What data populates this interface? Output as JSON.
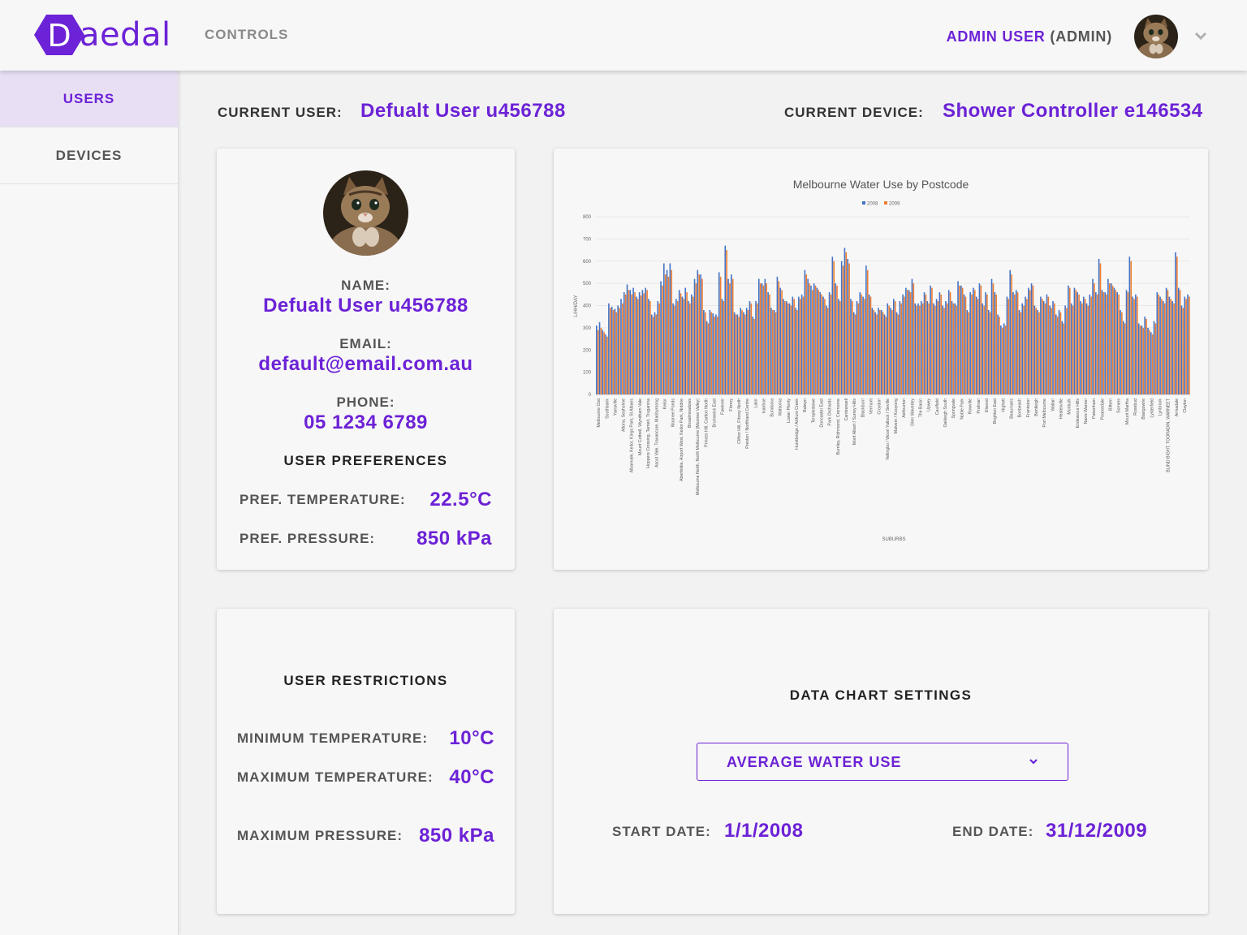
{
  "brand": {
    "logo_text": "aedal",
    "logo_letter": "D",
    "accent_color": "#6c22d6"
  },
  "topbar": {
    "nav_controls": "CONTROLS",
    "admin_name": "ADMIN USER",
    "admin_role": "(ADMIN)",
    "avatar_icon": "cat-avatar",
    "menu_icon": "chevron-down-icon"
  },
  "sidebar": {
    "items": [
      {
        "label": "USERS",
        "active": true
      },
      {
        "label": "DEVICES",
        "active": false
      }
    ]
  },
  "header": {
    "current_user_label": "CURRENT USER:",
    "current_user_value": "Defualt User u456788",
    "current_device_label": "CURRENT DEVICE:",
    "current_device_value": "Shower Controller e146534"
  },
  "user_card": {
    "name_label": "NAME:",
    "name_value": "Defualt User u456788",
    "email_label": "EMAIL:",
    "email_value": "default@email.com.au",
    "phone_label": "PHONE:",
    "phone_value": "05 1234 6789",
    "prefs_heading": "USER PREFERENCES",
    "pref_temp_label": "PREF. TEMPERATURE:",
    "pref_temp_value": "22.5°C",
    "pref_pressure_label": "PREF. PRESSURE:",
    "pref_pressure_value": "850 kPa"
  },
  "restrictions": {
    "heading": "USER RESTRICTIONS",
    "min_temp_label": "MINIMUM TEMPERATURE:",
    "min_temp_value": "10°C",
    "max_temp_label": "MAXIMUM TEMPERATURE:",
    "max_temp_value": "40°C",
    "max_pressure_label": "MAXIMUM PRESSURE:",
    "max_pressure_value": "850 kPa"
  },
  "chart_settings": {
    "heading": "DATA CHART SETTINGS",
    "dropdown_value": "AVERAGE WATER USE",
    "start_label": "START DATE:",
    "start_value": "1/1/2008",
    "end_label": "END DATE:",
    "end_value": "31/12/2009"
  },
  "chart_data": {
    "type": "bar",
    "title": "Melbourne Water Use by Postcode",
    "xlabel": "SUBURBS",
    "ylabel": "L/HH/DAY",
    "ylim": [
      0,
      800
    ],
    "yticks": [
      0,
      100,
      200,
      300,
      400,
      500,
      600,
      700,
      800
    ],
    "grid": true,
    "legend_position": "top",
    "series_colors": [
      "#4472c4",
      "#ed7d31"
    ],
    "labeled_categories": [
      "Melbourne Cbd",
      "Southbank",
      "Yarraville",
      "Altona, Seaholme",
      "Albanvale, Keilor, Kings Park, St Albans",
      "Mount Cottrell, Wyndham Vale",
      "Hoppers Crossing, Tarneit, Truganina",
      "Ascot Vale, Travancore, Maribyrnong",
      "Keilor",
      "Moonee Ponds",
      "Aberfeldie, Airport West, Keilor Park, Niddrie",
      "Broadmeadows",
      "Melbourne North, North Melbourne (Moonee Valley)",
      "Princes Hill, Carlton North",
      "Brunswick East",
      "Fawkner",
      "Fitzroy",
      "Clifton Hill, Fitzroy North",
      "Preston / Northland Centre",
      "Lalor",
      "Ivanhoe",
      "Bundoora",
      "Watsonia",
      "Lower Plenty",
      "Hurstbridge / Arthurs Creek",
      "Balwyn",
      "Templestowe",
      "Doncaster East",
      "Park Orchards",
      "Burnley, Richmond, Cremorne",
      "Camberwell",
      "Mont Albert / Surrey Hills",
      "Blackburn",
      "Vermont",
      "Croydon",
      "Yellingbo / Woori Yallock / Seville",
      "Malvern / Kooyong",
      "Ashburton",
      "Glen Waverley",
      "The Basin",
      "Upwey",
      "Caulfield",
      "Oakleigh South",
      "Springvale",
      "Noble Park",
      "Rowville",
      "Prahran",
      "Elwood",
      "Brighton East",
      "Highett",
      "Beaumaris",
      "Bonbeach",
      "Frankston",
      "Bentleigh",
      "Port Melbourne",
      "Wallan",
      "Healesville",
      "Monbulk",
      "Endeavour Hills",
      "Narre Warren",
      "Pakenham",
      "Pearcedale",
      "Bittern",
      "Somers",
      "Mount Martha",
      "Rosebud",
      "Blairgowrie",
      "Lysterfield",
      "Lynbrook",
      "BLIND BIGHT, TOORADIN, WARNEET",
      "Armadale",
      "Clayton"
    ],
    "series": [
      {
        "name": "2008",
        "values": [
          310,
          325,
          290,
          270,
          410,
          395,
          385,
          400,
          430,
          460,
          495,
          470,
          480,
          440,
          460,
          470,
          480,
          430,
          360,
          370,
          420,
          510,
          590,
          560,
          590,
          410,
          430,
          470,
          440,
          480,
          420,
          450,
          520,
          560,
          540,
          380,
          330,
          380,
          365,
          360,
          550,
          430,
          670,
          520,
          540,
          370,
          360,
          390,
          370,
          390,
          420,
          350,
          420,
          520,
          500,
          520,
          460,
          390,
          380,
          530,
          480,
          430,
          420,
          410,
          440,
          390,
          440,
          450,
          560,
          520,
          490,
          500,
          480,
          460,
          440,
          400,
          460,
          620,
          500,
          430,
          600,
          660,
          610,
          430,
          370,
          420,
          460,
          440,
          580,
          450,
          390,
          370,
          390,
          380,
          360,
          410,
          390,
          430,
          370,
          420,
          450,
          480,
          470,
          520,
          410,
          410,
          420,
          460,
          420,
          490,
          410,
          430,
          460,
          400,
          420,
          470,
          420,
          410,
          510,
          490,
          450,
          380,
          460,
          480,
          440,
          500,
          410,
          460,
          380,
          520,
          460,
          360,
          310,
          320,
          440,
          560,
          460,
          470,
          380,
          410,
          440,
          480,
          500,
          400,
          380,
          440,
          420,
          450,
          400,
          420,
          360,
          380,
          330,
          400,
          490,
          410,
          480,
          460,
          420,
          440,
          410,
          450,
          520,
          460,
          610,
          470,
          460,
          520,
          500,
          480,
          460,
          380,
          330,
          470,
          620,
          440,
          450,
          320,
          310,
          350,
          300,
          280,
          330,
          460,
          440,
          420,
          480,
          440,
          420,
          640,
          480,
          400,
          440,
          450
        ]
      },
      {
        "name": "2009",
        "values": [
          290,
          300,
          280,
          260,
          390,
          380,
          370,
          390,
          410,
          450,
          470,
          450,
          460,
          430,
          445,
          455,
          470,
          420,
          350,
          360,
          410,
          490,
          540,
          530,
          560,
          400,
          420,
          455,
          430,
          460,
          410,
          440,
          500,
          540,
          520,
          370,
          320,
          370,
          350,
          350,
          530,
          420,
          650,
          500,
          520,
          360,
          350,
          380,
          360,
          380,
          410,
          340,
          410,
          500,
          490,
          500,
          450,
          380,
          370,
          510,
          470,
          420,
          410,
          400,
          430,
          380,
          430,
          440,
          540,
          500,
          470,
          490,
          470,
          450,
          430,
          390,
          450,
          600,
          490,
          420,
          580,
          640,
          590,
          420,
          360,
          410,
          450,
          430,
          560,
          440,
          380,
          360,
          380,
          370,
          350,
          400,
          380,
          420,
          360,
          410,
          440,
          470,
          460,
          500,
          400,
          400,
          410,
          450,
          410,
          480,
          400,
          420,
          450,
          390,
          410,
          460,
          410,
          400,
          490,
          480,
          440,
          370,
          450,
          470,
          430,
          490,
          400,
          450,
          370,
          500,
          450,
          350,
          300,
          310,
          430,
          540,
          450,
          460,
          370,
          400,
          430,
          470,
          490,
          390,
          370,
          430,
          410,
          440,
          390,
          410,
          350,
          370,
          320,
          390,
          480,
          400,
          470,
          450,
          410,
          430,
          400,
          440,
          500,
          450,
          590,
          460,
          450,
          500,
          490,
          470,
          450,
          370,
          320,
          460,
          600,
          430,
          440,
          310,
          300,
          340,
          290,
          270,
          320,
          450,
          430,
          410,
          470,
          430,
          410,
          620,
          470,
          390,
          430,
          440
        ]
      }
    ]
  }
}
